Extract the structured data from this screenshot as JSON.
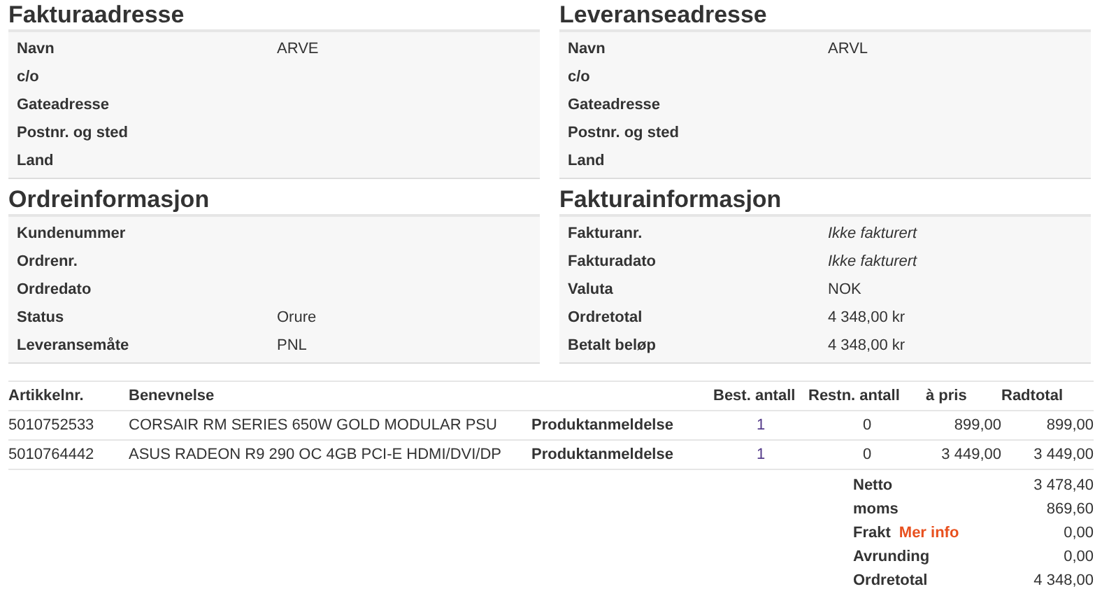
{
  "panels": [
    {
      "title": "Fakturaadresse",
      "rows": [
        {
          "label": "Navn",
          "value": "ARVE"
        },
        {
          "label": "c/o"
        },
        {
          "label": "Gateadresse"
        },
        {
          "label": "Postnr. og sted"
        },
        {
          "label": "Land"
        }
      ]
    },
    {
      "title": "Leveranseadresse",
      "rows": [
        {
          "label": "Navn",
          "value": "ARVL"
        },
        {
          "label": "c/o"
        },
        {
          "label": "Gateadresse"
        },
        {
          "label": "Postnr. og sted"
        },
        {
          "label": "Land"
        }
      ]
    },
    {
      "title": "Ordreinformasjon",
      "rows": [
        {
          "label": "Kundenummer"
        },
        {
          "label": "Ordrenr."
        },
        {
          "label": "Ordredato"
        },
        {
          "label": "Status",
          "value": "Orure"
        },
        {
          "label": "Leveransemåte",
          "value": "PNL"
        }
      ]
    },
    {
      "title": "Fakturainformasjon",
      "rows": [
        {
          "label": "Fakturanr.",
          "value": "Ikke fakturert",
          "italic": true
        },
        {
          "label": "Fakturadato",
          "value": "Ikke fakturert",
          "italic": true
        },
        {
          "label": "Valuta",
          "value": "NOK",
          "italic": false
        },
        {
          "label": "Ordretotal",
          "value": "4 348,00 kr",
          "italic": false
        },
        {
          "label": "Betalt beløp",
          "value": "4 348,00 kr",
          "italic": false
        }
      ]
    }
  ],
  "table": {
    "columns": [
      "Artikkelnr.",
      "Benevnelse",
      "Best. antall",
      "Restn. antall",
      "à pris",
      "Radtotal"
    ],
    "rows": [
      {
        "article": "5010752533",
        "name": "CORSAIR RM SERIES 650W GOLD MODULAR PSU",
        "review_link": "Produktanmeldelse",
        "ordered": "1",
        "backordered": "0",
        "unit_price": "899,00",
        "total": "899,00"
      },
      {
        "article": "5010764442",
        "name": "ASUS RADEON R9 290 OC 4GB PCI-E HDMI/DVI/DP",
        "review_link": "Produktanmeldelse",
        "ordered": "1",
        "backordered": "0",
        "unit_price": "3 449,00",
        "total": "3 449,00"
      }
    ]
  },
  "totals": [
    {
      "label": "Netto",
      "value": "3 478,40"
    },
    {
      "label": "moms",
      "value": "869,60"
    },
    {
      "label": "Frakt",
      "link": "Mer info",
      "value": "0,00"
    },
    {
      "label": "Avrunding",
      "value": "0,00"
    },
    {
      "label": "Ordretotal",
      "value": "4 348,00"
    }
  ]
}
